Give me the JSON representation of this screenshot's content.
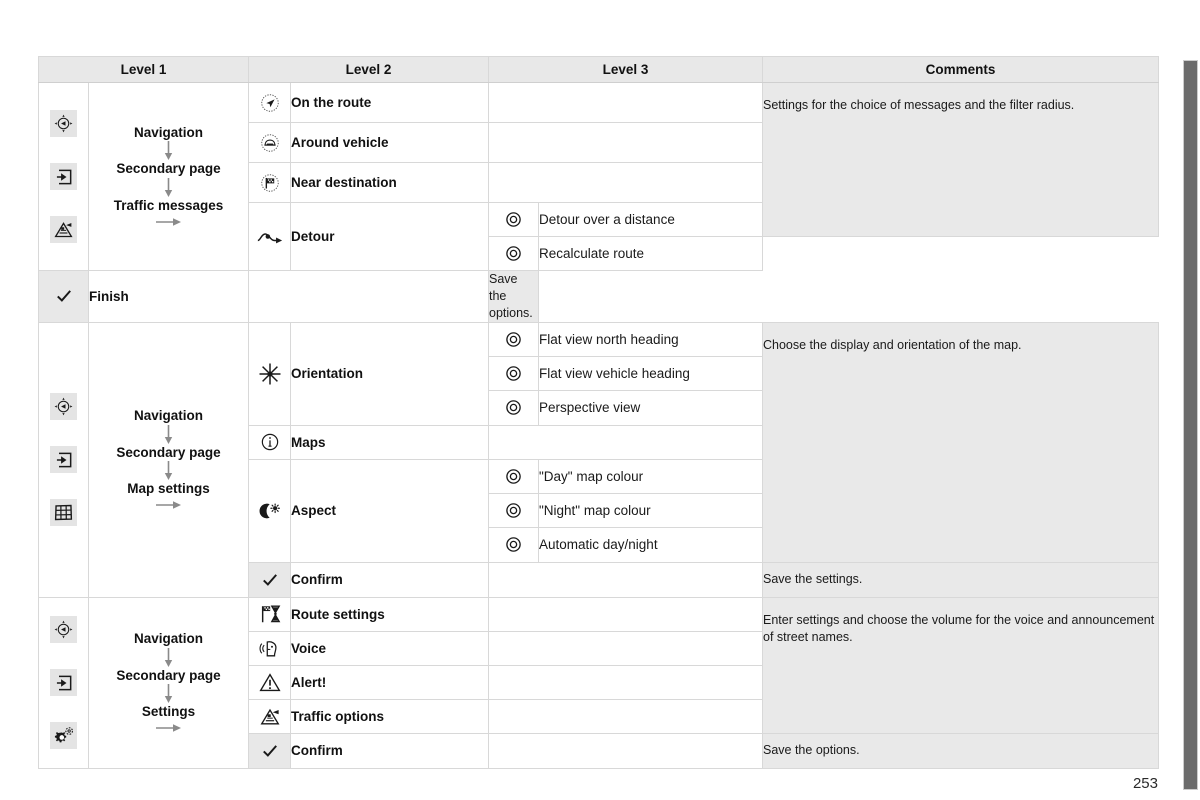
{
  "document": {
    "page_number": "253"
  },
  "table": {
    "headers": [
      "Level 1",
      "Level 2",
      "Level 3",
      "Comments"
    ],
    "blocks": [
      {
        "id": "traffic-messages",
        "level1_icons": [
          "navigation-compass-icon",
          "exit-page-icon",
          "traffic-incident-icon"
        ],
        "level1_flow": [
          "Navigation",
          "Secondary page",
          "Traffic messages"
        ],
        "rows": [
          {
            "l2_icon": "on-the-route-icon",
            "l2_label": "On the route",
            "l3": []
          },
          {
            "l2_icon": "around-vehicle-icon",
            "l2_label": "Around vehicle",
            "l3": []
          },
          {
            "l2_icon": "near-destination-icon",
            "l2_label": "Near destination",
            "l3": []
          },
          {
            "l2_icon": "detour-icon",
            "l2_label": "Detour",
            "l3": [
              "Detour over a distance",
              "Recalculate route"
            ]
          }
        ],
        "comment": "Settings for the choice of messages and the filter radius.",
        "confirm": {
          "icon": "check-icon",
          "label": "Finish",
          "comment": "Save the options."
        }
      },
      {
        "id": "map-settings",
        "level1_icons": [
          "navigation-compass-icon",
          "exit-page-icon",
          "map-grid-icon"
        ],
        "level1_flow": [
          "Navigation",
          "Secondary page",
          "Map settings"
        ],
        "rows": [
          {
            "l2_icon": "orientation-star-icon",
            "l2_label": "Orientation",
            "l3": [
              "Flat view north heading",
              "Flat view vehicle heading",
              "Perspective view"
            ]
          },
          {
            "l2_icon": "info-icon",
            "l2_label": "Maps",
            "l3": []
          },
          {
            "l2_icon": "day-night-icon",
            "l2_label": "Aspect",
            "l3": [
              "\"Day\" map colour",
              "\"Night\" map colour",
              "Automatic day/night"
            ]
          }
        ],
        "comment": "Choose the display and orientation of the map.",
        "confirm": {
          "icon": "check-icon",
          "label": "Confirm",
          "comment": "Save the settings."
        }
      },
      {
        "id": "settings",
        "level1_icons": [
          "navigation-compass-icon",
          "exit-page-icon",
          "gears-settings-icon"
        ],
        "level1_flow": [
          "Navigation",
          "Secondary page",
          "Settings"
        ],
        "rows": [
          {
            "l2_icon": "route-settings-flag-icon",
            "l2_label": "Route settings",
            "l3": []
          },
          {
            "l2_icon": "voice-icon",
            "l2_label": "Voice",
            "l3": []
          },
          {
            "l2_icon": "alert-warning-icon",
            "l2_label": "Alert!",
            "l3": []
          },
          {
            "l2_icon": "traffic-incident-icon",
            "l2_label": "Traffic options",
            "l3": []
          }
        ],
        "comment": "Enter settings and choose the volume for the voice and announcement of street names.",
        "confirm": {
          "icon": "check-icon",
          "label": "Confirm",
          "comment": "Save the options."
        }
      }
    ]
  },
  "colors": {
    "header_bg": "#e8e8e8",
    "comment_bg": "#e9e9e9",
    "icon_badge_bg": "#e4e4e4",
    "border": "#d8d8d8",
    "scrollbar_thumb": "#6b6b6b"
  }
}
